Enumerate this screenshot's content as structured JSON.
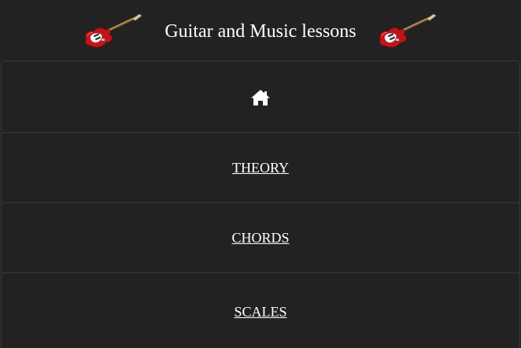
{
  "header": {
    "title": "Guitar and Music lessons",
    "left_image": "electric-guitar-icon",
    "right_image": "electric-guitar-icon"
  },
  "nav": {
    "items": [
      {
        "label": "",
        "icon": "home-icon"
      },
      {
        "label": "THEORY"
      },
      {
        "label": "CHORDS"
      },
      {
        "label": "SCALES"
      }
    ]
  },
  "colors": {
    "background": "#222222",
    "border": "#3a3a3a",
    "text": "#ffffff",
    "guitar_body": "#c0141a"
  }
}
